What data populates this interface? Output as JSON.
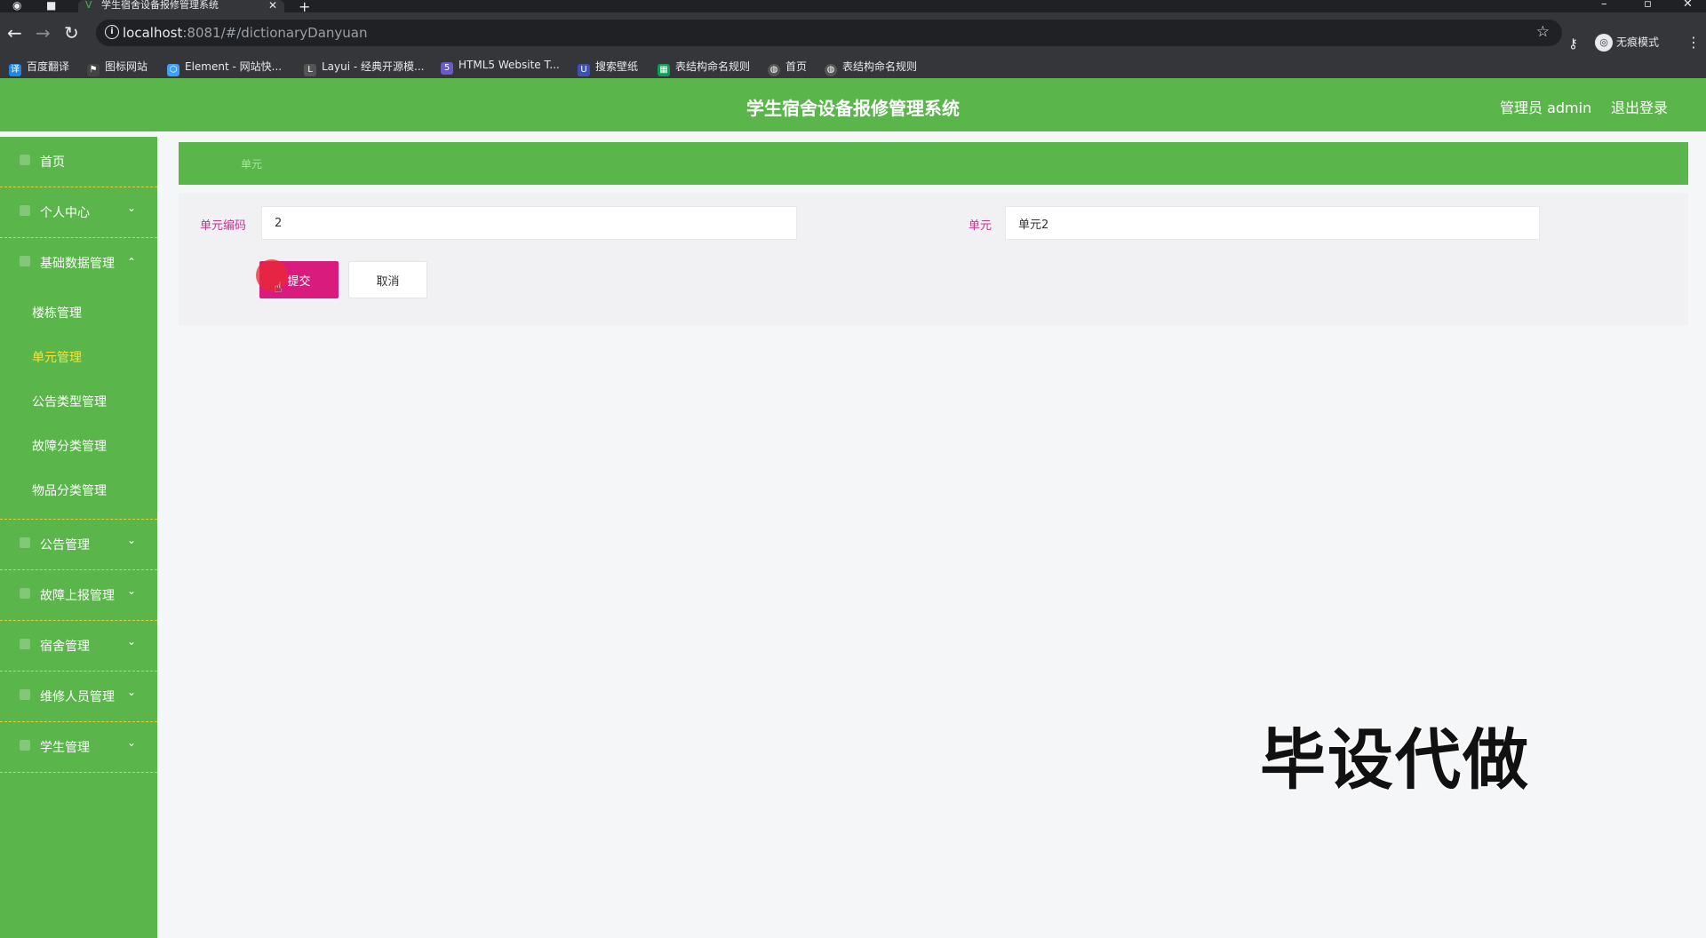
{
  "browser": {
    "tab_title": "学生宿舍设备报修管理系统",
    "url_host": "localhost",
    "url_rest": ":8081/#/dictionaryDanyuan",
    "incognito_label": "无痕模式",
    "bookmarks": [
      {
        "label": "百度翻译",
        "color": "#1e88e5"
      },
      {
        "label": "图标网站",
        "color": "#444444"
      },
      {
        "label": "Element - 网站快...",
        "color": "#409eff"
      },
      {
        "label": "Layui - 经典开源模...",
        "color": "#555555"
      },
      {
        "label": "HTML5 Website T...",
        "color": "#6a5acd"
      },
      {
        "label": "搜索壁纸",
        "color": "#3f51b5"
      },
      {
        "label": "表结构命名规则",
        "color": "#0f9d58"
      },
      {
        "label": "首页",
        "color": "#555555"
      },
      {
        "label": "表结构命名规则",
        "color": "#555555"
      }
    ]
  },
  "header": {
    "title": "学生宿舍设备报修管理系统",
    "user": "管理员 admin",
    "logout": "退出登录",
    "color": "#5ab54b"
  },
  "sidebar": {
    "items": [
      {
        "label": "首页",
        "has_children": false
      },
      {
        "label": "个人中心",
        "has_children": true
      },
      {
        "label": "基础数据管理",
        "has_children": true,
        "expanded": true
      }
    ],
    "submenu": [
      {
        "label": "楼栋管理",
        "active": false
      },
      {
        "label": "单元管理",
        "active": true
      },
      {
        "label": "公告类型管理",
        "active": false
      },
      {
        "label": "故障分类管理",
        "active": false
      },
      {
        "label": "物品分类管理",
        "active": false
      }
    ],
    "items_after": [
      {
        "label": "公告管理"
      },
      {
        "label": "故障上报管理"
      },
      {
        "label": "宿舍管理"
      },
      {
        "label": "维修人员管理"
      },
      {
        "label": "学生管理"
      }
    ],
    "active_color": "#f5e33b"
  },
  "breadcrumb": "单元",
  "form": {
    "code_label": "单元编码",
    "code_value": "2",
    "name_label": "单元",
    "name_value": "单元2",
    "submit": "提交",
    "cancel": "取消",
    "submit_color": "#d81b7d"
  },
  "watermark": "毕设代做"
}
